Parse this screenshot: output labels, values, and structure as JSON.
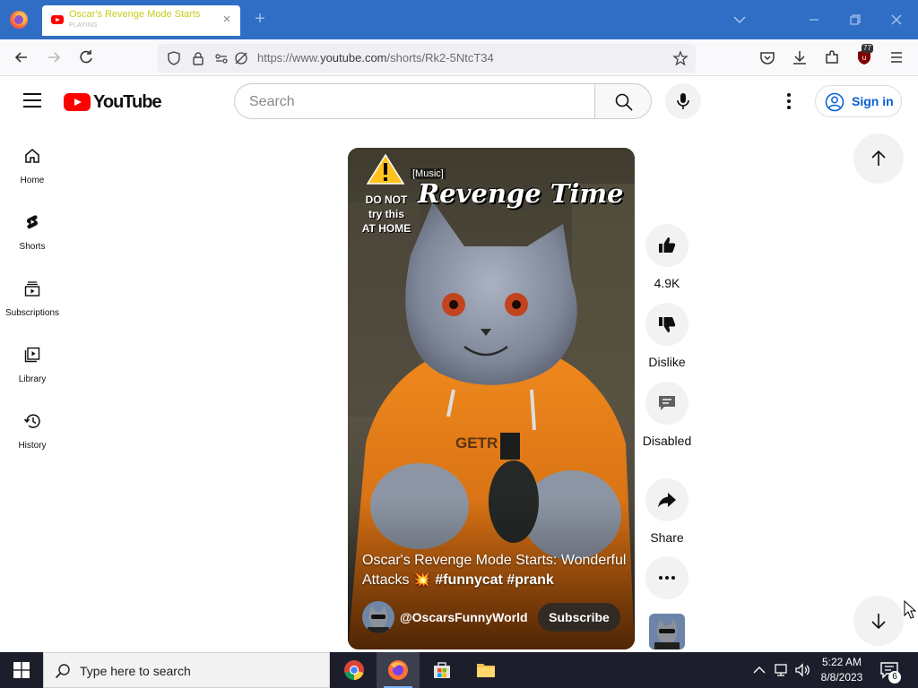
{
  "browser": {
    "tab": {
      "title": "Oscar's Revenge Mode Starts",
      "status": "PLAYING"
    },
    "url": {
      "prefix": "https://www.",
      "domain": "youtube.com",
      "path": "/shorts/Rk2-5NtcT34"
    },
    "extension_badge": "77"
  },
  "youtube": {
    "logo_text": "YouTube",
    "search_placeholder": "Search",
    "sign_in_label": "Sign in",
    "guide": [
      {
        "label": "Home",
        "icon": "home-icon"
      },
      {
        "label": "Shorts",
        "icon": "shorts-icon"
      },
      {
        "label": "Subscriptions",
        "icon": "subscriptions-icon"
      },
      {
        "label": "Library",
        "icon": "library-icon"
      },
      {
        "label": "History",
        "icon": "history-icon"
      }
    ],
    "short": {
      "caption": "[Music]",
      "overlay_title": "Revenge Time",
      "overlay_warning_1": "DO NOT",
      "overlay_warning_2": "try this",
      "overlay_warning_3": "AT HOME",
      "title_main": "Oscar's Revenge Mode Starts: Wonderful Attacks 💥",
      "title_tags": "#funnycat #prank",
      "channel": "@OscarsFunnyWorld",
      "subscribe_label": "Subscribe"
    },
    "actions": {
      "like_count": "4.9K",
      "dislike_label": "Dislike",
      "comments_label": "Disabled",
      "share_label": "Share"
    }
  },
  "taskbar": {
    "search_placeholder": "Type here to search",
    "time": "5:22 AM",
    "date": "8/8/2023",
    "notification_count": "6"
  },
  "colors": {
    "youtube_red": "#ff0000",
    "firefox_titlebar": "#2f6ec4",
    "link_blue": "#065fd4"
  }
}
